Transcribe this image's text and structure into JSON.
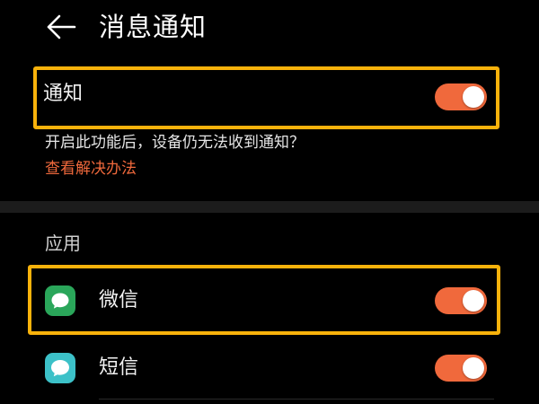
{
  "header": {
    "title": "消息通知",
    "back_icon": "arrow-left-icon"
  },
  "notification": {
    "label": "通知",
    "enabled": true
  },
  "hint": {
    "text": "开启此功能后，设备仍无法收到通知？",
    "link": "查看解决办法"
  },
  "apps_section": {
    "title": "应用",
    "items": [
      {
        "label": "微信",
        "icon": "wechat-icon",
        "enabled": true
      },
      {
        "label": "短信",
        "icon": "messages-icon",
        "enabled": true
      }
    ]
  },
  "colors": {
    "accent": "#f0693c",
    "highlight": "#f8b20b",
    "background": "#000000"
  }
}
